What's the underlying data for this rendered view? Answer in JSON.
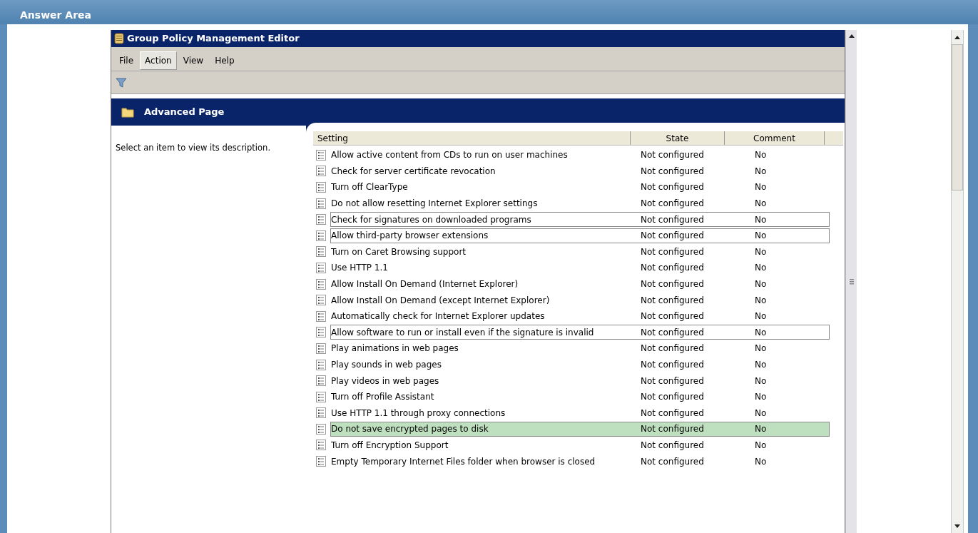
{
  "page": {
    "title": "Answer Area"
  },
  "window": {
    "title": "Group Policy Management Editor"
  },
  "menu": [
    {
      "label": "File",
      "selected": false
    },
    {
      "label": "Action",
      "selected": true
    },
    {
      "label": "View",
      "selected": false
    },
    {
      "label": "Help",
      "selected": false
    }
  ],
  "header": {
    "title": "Advanced Page"
  },
  "description": "Select an item to view its description.",
  "table": {
    "columns": [
      "Setting",
      "State",
      "Comment"
    ],
    "rows": [
      {
        "setting": "Allow active content from CDs to run on user machines",
        "state": "Not configured",
        "comment": "No",
        "kind": "plain"
      },
      {
        "setting": "Check for server certificate revocation",
        "state": "Not configured",
        "comment": "No",
        "kind": "plain"
      },
      {
        "setting": "Turn off ClearType",
        "state": "Not configured",
        "comment": "No",
        "kind": "plain"
      },
      {
        "setting": "Do not allow resetting Internet Explorer settings",
        "state": "Not configured",
        "comment": "No",
        "kind": "plain"
      },
      {
        "setting": "Check for signatures on downloaded programs",
        "state": "Not configured",
        "comment": "No",
        "kind": "boxed"
      },
      {
        "setting": "Allow third-party browser extensions",
        "state": "Not configured",
        "comment": "No",
        "kind": "boxed"
      },
      {
        "setting": "Turn on Caret Browsing support",
        "state": "Not configured",
        "comment": "No",
        "kind": "plain"
      },
      {
        "setting": "Use HTTP 1.1",
        "state": "Not configured",
        "comment": "No",
        "kind": "plain"
      },
      {
        "setting": "Allow Install On Demand (Internet Explorer)",
        "state": "Not configured",
        "comment": "No",
        "kind": "plain"
      },
      {
        "setting": "Allow Install On Demand (except Internet Explorer)",
        "state": "Not configured",
        "comment": "No",
        "kind": "plain"
      },
      {
        "setting": "Automatically check for Internet Explorer updates",
        "state": "Not configured",
        "comment": "No",
        "kind": "plain"
      },
      {
        "setting": "Allow software to run or install even if the signature is invalid",
        "state": "Not configured",
        "comment": "No",
        "kind": "boxed"
      },
      {
        "setting": "Play animations in web pages",
        "state": "Not configured",
        "comment": "No",
        "kind": "plain"
      },
      {
        "setting": "Play sounds in web pages",
        "state": "Not configured",
        "comment": "No",
        "kind": "plain"
      },
      {
        "setting": "Play videos in web pages",
        "state": "Not configured",
        "comment": "No",
        "kind": "plain"
      },
      {
        "setting": "Turn off Profile Assistant",
        "state": "Not configured",
        "comment": "No",
        "kind": "plain"
      },
      {
        "setting": "Use HTTP 1.1 through proxy connections",
        "state": "Not configured",
        "comment": "No",
        "kind": "plain"
      },
      {
        "setting": "Do not save encrypted pages to disk",
        "state": "Not configured",
        "comment": "No",
        "kind": "highlighted"
      },
      {
        "setting": "Turn off Encryption Support",
        "state": "Not configured",
        "comment": "No",
        "kind": "plain"
      },
      {
        "setting": "Empty Temporary Internet Files folder when browser is closed",
        "state": "Not configured",
        "comment": "No",
        "kind": "plain"
      }
    ]
  }
}
